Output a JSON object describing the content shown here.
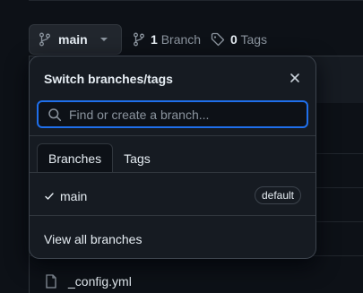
{
  "repo": {
    "branch_button_label": "main",
    "branch_count": "1",
    "branch_label": "Branch",
    "tag_count": "0",
    "tag_label": "Tags"
  },
  "dropdown": {
    "title": "Switch branches/tags",
    "close_icon": "close-icon",
    "search_placeholder": "Find or create a branch...",
    "tabs": [
      {
        "label": "Branches",
        "active": true
      },
      {
        "label": "Tags",
        "active": false
      }
    ],
    "branches": [
      {
        "name": "main",
        "selected": true,
        "badge": "default"
      }
    ],
    "view_all_label": "View all branches"
  },
  "files": [
    {
      "name": "_config.yml"
    }
  ],
  "colors": {
    "background": "#0d1117",
    "panel": "#161b22",
    "focus_border": "#1f6feb",
    "muted_text": "#8b949e"
  }
}
